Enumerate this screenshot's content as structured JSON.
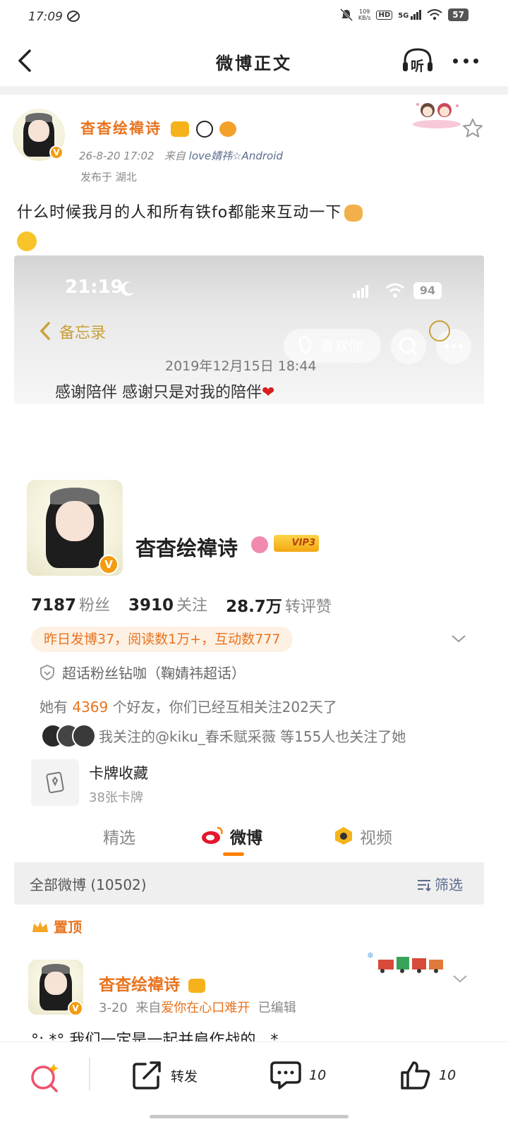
{
  "status_bar": {
    "time": "17:09",
    "speed_top": "109",
    "speed_unit": "KB/s",
    "hd": "HD",
    "network": "5G",
    "battery": "57"
  },
  "nav": {
    "title": "微博正文",
    "listen_label": "听"
  },
  "post": {
    "author": "杳杳绘禕诗",
    "date": "26-8-20 17:02",
    "source_prefix": "来自",
    "source": "love婧祎☆Android",
    "location": "发布于 湖北",
    "text": "什么时候我月的人和所有铁fo都能来互动一下"
  },
  "screenshot": {
    "time": "21:19",
    "battery": "94",
    "back_label": "备忘录",
    "like_label": "喜欢你",
    "note_date": "2019年12月15日 18:44",
    "note_text": "感谢陪伴 感谢只是对我的陪伴",
    "profile": {
      "name": "杳杳绘禕诗",
      "vip": "VIP3",
      "fans_num": "7187",
      "fans_label": "粉丝",
      "follow_num": "3910",
      "follow_label": "关注",
      "engage_num": "28.7万",
      "engage_label": "转评赞",
      "yesterday": "昨日发博37，阅读数1万+，互动数777",
      "fan_title": "超话粉丝钻咖（鞠婧祎超话）",
      "friends_pre": "她有",
      "friends_num": "4369",
      "friends_post": "个好友，你们已经互相关注202天了",
      "mutual": "我关注的@kiku_春禾赋采薇 等155人也关注了她",
      "card_title": "卡牌收藏",
      "card_sub": "38张卡牌"
    },
    "tabs": [
      "精选",
      "微博",
      "视频"
    ],
    "all_posts": "全部微博 (10502)",
    "filter": "筛选"
  },
  "pinned": {
    "label": "置顶",
    "author": "杳杳绘禕诗",
    "date": "3-20",
    "source_prefix": "来自",
    "source": "爱你在心口难开",
    "edited": "已编辑",
    "text": "°:.*° 我们一定是一起并肩作战的 . *"
  },
  "bottom": {
    "repost_label": "转发",
    "comment_count": "10",
    "like_count": "10"
  },
  "colors": {
    "accent_orange": "#e8731e",
    "link_blue": "#5a6b8c",
    "heart_red": "#d81e1e"
  }
}
